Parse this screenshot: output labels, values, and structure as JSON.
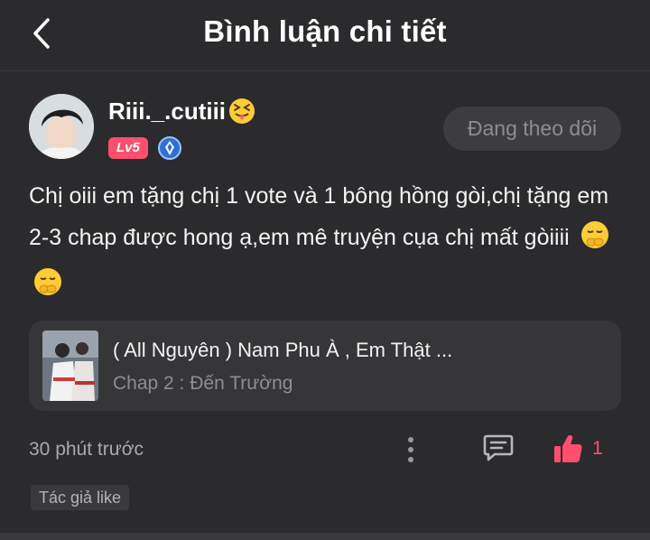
{
  "header": {
    "title": "Bình luận chi tiết",
    "back_icon": "chevron-left-icon"
  },
  "user": {
    "name": "Riii._.cutiii",
    "name_emoji": "squinting-tongue-emoji",
    "level": "Lv5",
    "verified_icon": "diamond-badge-icon",
    "follow_label": "Đang theo dõi"
  },
  "comment": {
    "text": "Chị oiii em tặng chị 1 vote và 1 bông hồng gòi,chị tặng em 2-3 chap được hong ạ,em mê truyện cụa chị mất gòiiii",
    "emojis": [
      "shushing-face-emoji",
      "shushing-face-emoji"
    ]
  },
  "story": {
    "title": "( All Nguyên ) Nam Phu À , Em Thật ...",
    "chapter": "Chap 2 : Đến Trường"
  },
  "meta": {
    "time": "30 phút trước",
    "like_count": "1",
    "author_like": "Tác giả like"
  },
  "colors": {
    "background": "#2b2b2d",
    "accent": "#ff4f6d",
    "card": "#363638"
  }
}
